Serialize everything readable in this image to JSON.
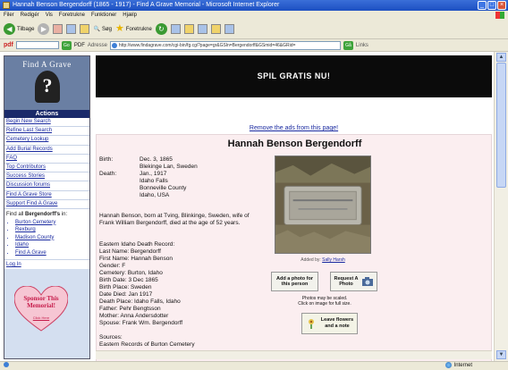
{
  "window": {
    "title": "Hannah Benson Bergendorff (1865 - 1917) - Find A Grave Memorial - Microsoft Internet Explorer",
    "menu": [
      "Filer",
      "Redigér",
      "Vis",
      "Foretrukne",
      "Funktioner",
      "Hjælp"
    ]
  },
  "toolbar": {
    "back_label": "Tilbage",
    "search_label": "Søg",
    "favorites_label": "Foretrukne"
  },
  "addressbar": {
    "pdf_label": "pdf",
    "go_label": "Go",
    "pdf_button_label": "PDF",
    "address_label": "Adresse",
    "url": "http://www.findagrave.com/cgi-bin/fg.cgi?page=gr&GSln=Bergendorff&GSmid=46&GRid=",
    "go_button": "Gå",
    "links_label": "Links"
  },
  "status": {
    "left": "",
    "zone": "Internet"
  },
  "leftnav": {
    "logo_text": "Find A Grave",
    "actions_heading": "Actions",
    "items": [
      "Begin New Search",
      "Refine Last Search",
      "Cemetery Lookup",
      "Add Burial Records",
      "FAQ",
      "Top Contributors",
      "Success Stories",
      "Discussion forums",
      "Find A Grave Store",
      "Support Find A Grave"
    ],
    "find_all_prefix": "Find all ",
    "find_all_name": "Bergendorff's",
    "find_all_suffix": " in:",
    "find_all_places": [
      "Burton Cemetery",
      "Rexburg",
      "Madison County",
      "Idaho",
      "Find A Grave"
    ],
    "login": "Log In",
    "sponsor_text": "Sponsor This Memorial!",
    "sponsor_sub": "Click Here"
  },
  "banner": {
    "text": "SPIL GRATIS NU!"
  },
  "memorial": {
    "remove_ads": "Remove the ads from this page!",
    "name": "Hannah Benson Bergendorff",
    "birth_label": "Birth:",
    "birth_lines": [
      "Dec. 3, 1865",
      "Blekinge Lan, Sweden"
    ],
    "death_label": "Death:",
    "death_lines": [
      "Jan., 1917",
      "Idaho Falls",
      "Bonneville County",
      "Idaho, USA"
    ],
    "bio": "Hannah Benson, born at Tving, Blinkinge, Sweden, wife of Frank William Bergendorff, died at the age of 52 years.",
    "record_lines": [
      "Eastern Idaho Death Record:",
      "Last Name: Bergendorff",
      "First Name: Hannah Benson",
      "Gender: F",
      "Cemetery: Burton, Idaho",
      "Birth Date: 3 Dec 1865",
      "Birth Place: Sweden",
      "Date Died: Jan 1917",
      "Death Place: Idaho Falls, Idaho",
      "Father: Pehr Bengtsson",
      "Mother: Anna Andersdotter",
      "Spouse: Frank Wm. Bergendorff"
    ],
    "sources_label": "Sources:",
    "sources_line": "Eastern Records of Burton Cemetery",
    "added_by_prefix": "Added by: ",
    "added_by_name": "Sally Harsh",
    "add_photo": "Add a photo for this person",
    "request_photo": "Request A Photo",
    "photo_note_1": "Photos may be scaled.",
    "photo_note_2": "Click on image for full size.",
    "flowers": "Leave flowers and a note"
  },
  "colors": {
    "nav_bg": "#d4dff0",
    "actions_bg": "#1a2a6a",
    "memorial_bg": "#fbeef0",
    "banner_bg": "#0b0b0b",
    "link": "#1a2aa0"
  }
}
